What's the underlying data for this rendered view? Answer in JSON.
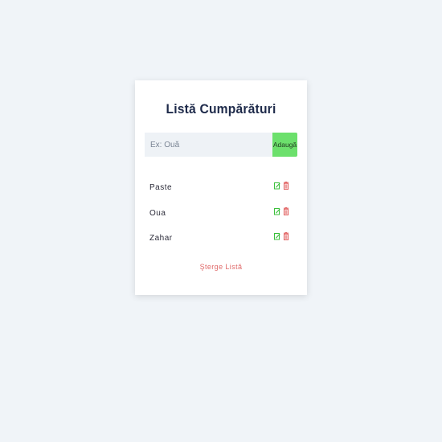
{
  "app": {
    "title": "Listă Cumpărături"
  },
  "form": {
    "placeholder": "Ex: Ouă",
    "value": "",
    "add_label": "Adaugă"
  },
  "items": [
    {
      "label": "Paste",
      "edit_icon": "edit-icon",
      "delete_icon": "trash-icon"
    },
    {
      "label": "Oua",
      "edit_icon": "edit-icon",
      "delete_icon": "trash-icon"
    },
    {
      "label": "Zahar",
      "edit_icon": "edit-icon",
      "delete_icon": "trash-icon"
    }
  ],
  "clear_label": "Şterge Listă",
  "colors": {
    "background": "#f0f4f8",
    "card": "#ffffff",
    "title": "#1e2a4a",
    "add_button": "#6ce06c",
    "edit_icon": "#3bbf3b",
    "delete_icon": "#e05a5a",
    "clear_link": "#e06b6b"
  }
}
